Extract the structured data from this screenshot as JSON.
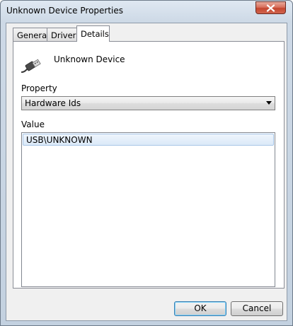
{
  "window": {
    "title": "Unknown Device Properties"
  },
  "tabs": [
    {
      "label": "General",
      "active": false
    },
    {
      "label": "Driver",
      "active": false
    },
    {
      "label": "Details",
      "active": true
    }
  ],
  "details": {
    "device_name": "Unknown Device",
    "device_icon": "usb-plug-icon",
    "property_label": "Property",
    "property_selected": "Hardware Ids",
    "value_label": "Value",
    "values": [
      "USB\\UNKNOWN"
    ]
  },
  "buttons": {
    "ok_label": "OK",
    "cancel_label": "Cancel"
  },
  "colors": {
    "titlebar": "#cdd9e6",
    "close_button": "#c4462f",
    "selection": "#dbe9f8",
    "default_button_border": "#3c7fb1"
  }
}
